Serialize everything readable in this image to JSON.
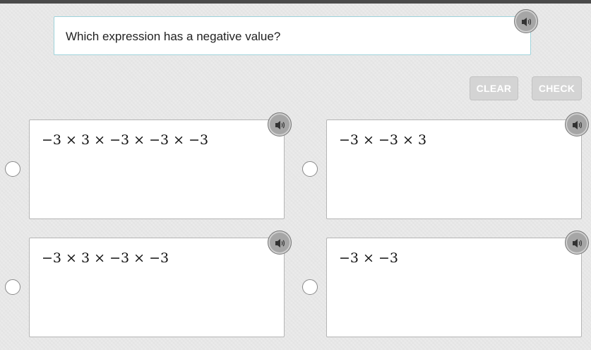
{
  "question": {
    "text": "Which expression has a negative value?",
    "audio_icon": "speaker-icon"
  },
  "toolbar": {
    "clear_label": "CLEAR",
    "check_label": "CHECK"
  },
  "options": [
    {
      "expression": "−3 × 3 × −3 × −3 × −3",
      "audio_icon": "speaker-icon",
      "selected": false
    },
    {
      "expression": "−3 × −3 × 3",
      "audio_icon": "speaker-icon",
      "selected": false
    },
    {
      "expression": "−3 × 3 × −3 × −3",
      "audio_icon": "speaker-icon",
      "selected": false
    },
    {
      "expression": "−3 × −3",
      "audio_icon": "speaker-icon",
      "selected": false
    }
  ],
  "colors": {
    "background": "#ebebeb",
    "top_bar": "#4a4a4a",
    "question_border": "#9fd3db",
    "button_disabled": "#d4d4d4",
    "speaker": "#a6a6a6"
  }
}
